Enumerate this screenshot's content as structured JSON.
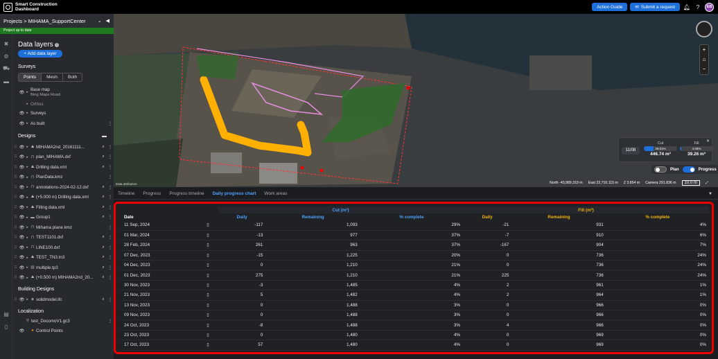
{
  "app": {
    "title_line1": "Smart Construction",
    "title_line2": "Dashboard"
  },
  "topbar": {
    "action_guide": "Action Guide",
    "submit_request": "Submit a request",
    "avatar": "EB"
  },
  "project": {
    "breadcrumb": "Projects > MIHAMA_SupportCenter",
    "status": "Project up to date"
  },
  "panel": {
    "title": "Data layers",
    "add_button": "+ Add data layer",
    "surveys_label": "Surveys",
    "seg": [
      "Points",
      "Mesh",
      "Both"
    ],
    "basemap": {
      "name": "Base map",
      "sub": "Bing Maps Road"
    },
    "orthos": "Orthos",
    "surveys": "Surveys",
    "as_built": "As built",
    "designs_label": "Designs",
    "designs": [
      "MIHAMA2nd_20161111...",
      "plan_MIHAMA.dxf",
      "Drilling data.xml",
      "PlanData.kmz",
      "annotations-2024-02-12.dxf",
      "(+5.000 m) Drilling data.xml",
      "Filling data.xml",
      "Group1",
      "Mihama plane.kmz",
      "TEST1101.dxf",
      "LINE100.dxf",
      "TEST_TN3.tn3",
      "multiple.tp3",
      "(+0.500 m) MIHAMA2nd_20..."
    ],
    "building_label": "Building Designs",
    "building": "solidmodel.ifc",
    "localization_label": "Localization",
    "gc3": "test_DocomoV1.gc3",
    "control_points": "Control Points"
  },
  "map": {
    "attribution": "Data attribution",
    "north": "North -43,989.319 m",
    "east": "East 22,710.115 m",
    "z": "Z 3.654 m",
    "camera": "Camera 291.836 m",
    "scale": "10.0 m",
    "cutfill": {
      "date": "11/08",
      "cut_label": "Cut",
      "cut_pct": "29.01%",
      "cut_val": "446.74 m³",
      "fill_label": "Fill",
      "fill_pct": "4.05%",
      "fill_val": "39.26 m³"
    },
    "toggle_plan": "Plan",
    "toggle_progress": "Progress"
  },
  "tabs": [
    "Timeline",
    "Progress",
    "Progress timeline",
    "Daily progress chart",
    "Work areas"
  ],
  "table": {
    "cut_group": "Cut (m³)",
    "fill_group": "Fill (m³)",
    "headers": {
      "date": "Date",
      "daily": "Daily",
      "remaining": "Remaining",
      "complete": "% complete"
    },
    "rows": [
      [
        "11 Sep, 2024",
        "-117",
        "1,093",
        "29%",
        "-21",
        "931",
        "4%"
      ],
      [
        "01 Mar, 2024",
        "-13",
        "977",
        "37%",
        "-7",
        "910",
        "6%"
      ],
      [
        "28 Feb, 2024",
        "261",
        "963",
        "37%",
        "-167",
        "904",
        "7%"
      ],
      [
        "07 Dec, 2023",
        "-15",
        "1,225",
        "20%",
        "0",
        "736",
        "24%"
      ],
      [
        "04 Dec, 2023",
        "0",
        "1,210",
        "21%",
        "0",
        "736",
        "24%"
      ],
      [
        "01 Dec, 2023",
        "275",
        "1,210",
        "21%",
        "225",
        "736",
        "24%"
      ],
      [
        "30 Nov, 2023",
        "-3",
        "1,485",
        "4%",
        "2",
        "961",
        "1%"
      ],
      [
        "21 Nov, 2023",
        "5",
        "1,482",
        "4%",
        "2",
        "964",
        "1%"
      ],
      [
        "13 Nov, 2023",
        "0",
        "1,488",
        "3%",
        "0",
        "966",
        "0%"
      ],
      [
        "09 Nov, 2023",
        "0",
        "1,488",
        "3%",
        "0",
        "966",
        "0%"
      ],
      [
        "24 Oct, 2023",
        "-8",
        "1,488",
        "3%",
        "4",
        "966",
        "0%"
      ],
      [
        "23 Oct, 2023",
        "0",
        "1,480",
        "4%",
        "0",
        "969",
        "0%"
      ],
      [
        "17 Oct, 2023",
        "57",
        "1,480",
        "4%",
        "0",
        "969",
        "0%"
      ]
    ]
  }
}
